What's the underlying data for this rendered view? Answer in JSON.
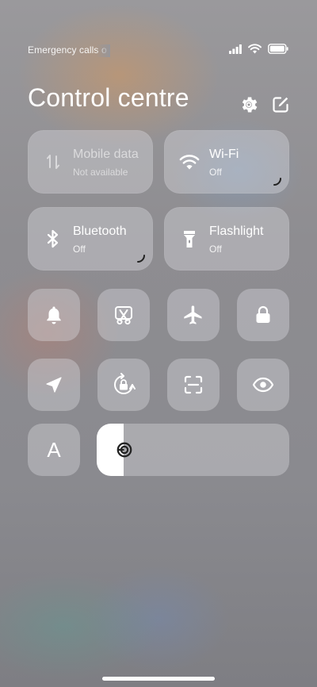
{
  "status_bar": {
    "carrier_text": "Emergency calls o",
    "icons": [
      "cellular-signal-icon",
      "wifi-icon",
      "battery-icon"
    ]
  },
  "header": {
    "title": "Control centre",
    "actions": [
      "gear-icon",
      "edit-icon"
    ]
  },
  "toggles": [
    {
      "id": "mobile-data",
      "label": "Mobile data",
      "status": "Not available",
      "icon": "mobile-data-icon",
      "enabled": false
    },
    {
      "id": "wifi",
      "label": "Wi-Fi",
      "status": "Off",
      "icon": "wifi-icon",
      "enabled": true
    },
    {
      "id": "bluetooth",
      "label": "Bluetooth",
      "status": "Off",
      "icon": "bluetooth-icon",
      "enabled": true
    },
    {
      "id": "flashlight",
      "label": "Flashlight",
      "status": "Off",
      "icon": "flashlight-icon",
      "enabled": true
    }
  ],
  "quick_buttons_row1": [
    "bell-icon",
    "screenshot-icon",
    "airplane-icon",
    "lock-icon"
  ],
  "quick_buttons_row2": [
    "location-icon",
    "rotation-lock-icon",
    "scanner-icon",
    "eye-icon"
  ],
  "font_button": {
    "label": "A",
    "icon": "font-size-icon"
  },
  "brightness": {
    "level": 0.14,
    "icon": "brightness-icon"
  },
  "colors": {
    "tile_bg": "#d8d8dd",
    "text": "#ffffff",
    "icon": "#ffffff"
  }
}
